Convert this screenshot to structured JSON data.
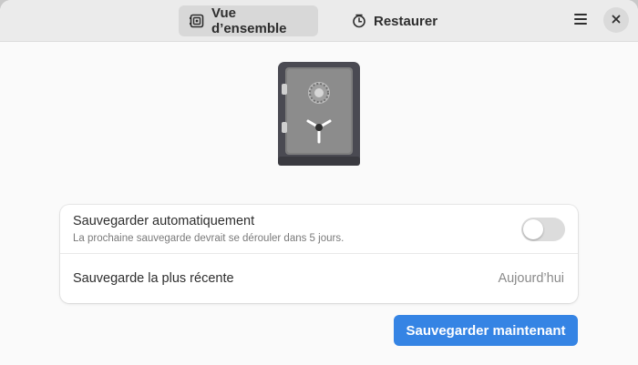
{
  "headerbar": {
    "tabs": [
      {
        "label": "Vue d’ensemble",
        "icon": "safe-icon",
        "active": true
      },
      {
        "label": "Restaurer",
        "icon": "clock-icon",
        "active": false
      }
    ],
    "menu_icon": "hamburger-menu-icon",
    "close_icon": "close-icon"
  },
  "hero": {
    "icon": "safe-illustration"
  },
  "settings": {
    "auto_backup": {
      "title": "Sauvegarder automatiquement",
      "subtitle": "La prochaine sauvegarde devrait se dérouler dans 5 jours.",
      "toggle_on": false
    },
    "last_backup": {
      "title": "Sauvegarde la plus récente",
      "value": "Aujourd’hui"
    }
  },
  "actions": {
    "backup_now_label": "Sauvegarder maintenant"
  },
  "colors": {
    "accent": "#3584e4",
    "headerbar": "#ebebeb",
    "background": "#fafafa"
  }
}
